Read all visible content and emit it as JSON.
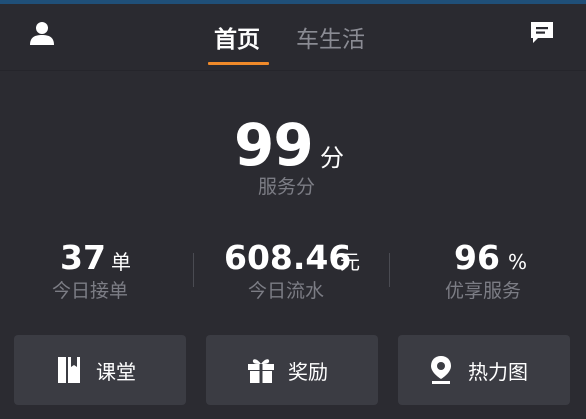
{
  "header": {
    "profile_icon": "person-icon",
    "message_icon": "chat-message-icon",
    "tabs": [
      {
        "label": "首页",
        "active": true
      },
      {
        "label": "车生活",
        "active": false
      }
    ],
    "accent_color": "#f08a2a"
  },
  "score": {
    "value": "99",
    "unit": "分",
    "label": "服务分"
  },
  "stats": [
    {
      "value": "37",
      "unit": "单",
      "label": "今日接单"
    },
    {
      "value": "608.46",
      "unit": "元",
      "label": "今日流水"
    },
    {
      "value": "96",
      "unit": "%",
      "label": "优享服务"
    }
  ],
  "actions": [
    {
      "label": "课堂",
      "icon": "book-icon"
    },
    {
      "label": "奖励",
      "icon": "gift-icon"
    },
    {
      "label": "热力图",
      "icon": "location-pin-icon"
    }
  ]
}
